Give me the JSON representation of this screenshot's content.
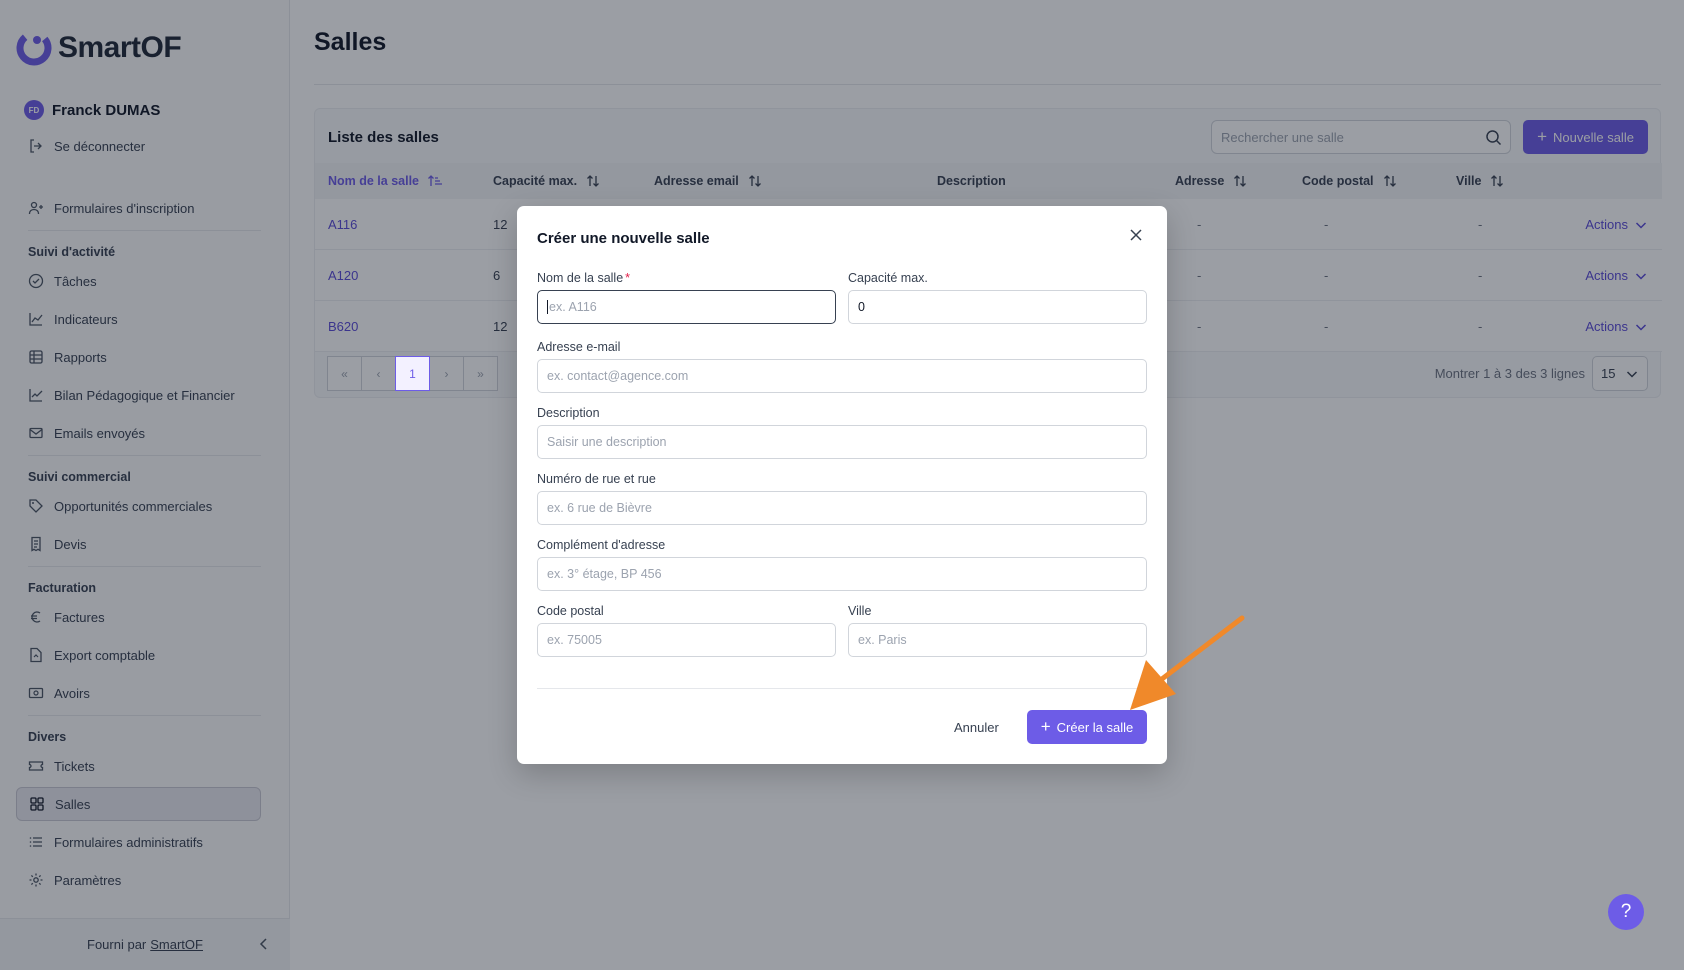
{
  "app": {
    "brand": "SmartOF",
    "brand_color": "#6d5ce7",
    "user_initials": "FD",
    "user_name": "Franck DUMAS",
    "logout": "Se déconnecter"
  },
  "sidebar": {
    "top_items": [
      {
        "label": "Formulaires d'inscription",
        "icon": "user-form-icon"
      }
    ],
    "sections": [
      {
        "title": "Suivi d'activité",
        "items": [
          {
            "label": "Tâches",
            "icon": "check-circle-icon"
          },
          {
            "label": "Indicateurs",
            "icon": "chart-line-icon"
          },
          {
            "label": "Rapports",
            "icon": "table-icon"
          },
          {
            "label": "Bilan Pédagogique et Financier",
            "icon": "chart-up-icon"
          },
          {
            "label": "Emails envoyés",
            "icon": "mail-icon"
          }
        ]
      },
      {
        "title": "Suivi commercial",
        "items": [
          {
            "label": "Opportunités commerciales",
            "icon": "tag-icon"
          },
          {
            "label": "Devis",
            "icon": "receipt-icon"
          }
        ]
      },
      {
        "title": "Facturation",
        "items": [
          {
            "label": "Factures",
            "icon": "euro-icon"
          },
          {
            "label": "Export comptable",
            "icon": "file-export-icon"
          },
          {
            "label": "Avoirs",
            "icon": "banknote-icon"
          }
        ]
      },
      {
        "title": "Divers",
        "items": [
          {
            "label": "Tickets",
            "icon": "ticket-icon"
          },
          {
            "label": "Salles",
            "icon": "grid-icon",
            "active": true
          },
          {
            "label": "Formulaires administratifs",
            "icon": "list-icon"
          },
          {
            "label": "Paramètres",
            "icon": "gear-icon"
          }
        ]
      }
    ],
    "footer_prefix": "Fourni par",
    "footer_link": "SmartOF"
  },
  "page": {
    "title": "Salles",
    "card_title": "Liste des salles",
    "search_placeholder": "Rechercher une salle",
    "new_button": "Nouvelle salle",
    "columns": [
      "Nom de la salle",
      "Capacité max.",
      "Adresse email",
      "Description",
      "Adresse",
      "Code postal",
      "Ville"
    ],
    "rows": [
      {
        "name": "A116",
        "capacity": "12",
        "address": "-",
        "postal": "-",
        "city": "-",
        "actions": "Actions"
      },
      {
        "name": "A120",
        "capacity": "6",
        "address": "-",
        "postal": "-",
        "city": "-",
        "actions": "Actions"
      },
      {
        "name": "B620",
        "capacity": "12",
        "address": "-",
        "postal": "-",
        "city": "-",
        "actions": "Actions"
      }
    ],
    "current_page": "1",
    "pager_info": "Montrer 1 à 3 des 3 lignes",
    "per_page": "15",
    "help": "?"
  },
  "modal": {
    "title": "Créer une nouvelle salle",
    "name_label": "Nom de la salle",
    "required_mark": "*",
    "name_placeholder": "ex. A116",
    "capacity_label": "Capacité max.",
    "capacity_value": "0",
    "email_label": "Adresse e-mail",
    "email_placeholder": "ex. contact@agence.com",
    "description_label": "Description",
    "description_placeholder": "Saisir une description",
    "street_label": "Numéro de rue et rue",
    "street_placeholder": "ex. 6 rue de Bièvre",
    "complement_label": "Complément d'adresse",
    "complement_placeholder": "ex. 3° étage, BP 456",
    "postal_label": "Code postal",
    "postal_placeholder": "ex. 75005",
    "city_label": "Ville",
    "city_placeholder": "ex. Paris",
    "cancel": "Annuler",
    "submit": "Créer la salle"
  },
  "annotation_color": "#f0892a"
}
